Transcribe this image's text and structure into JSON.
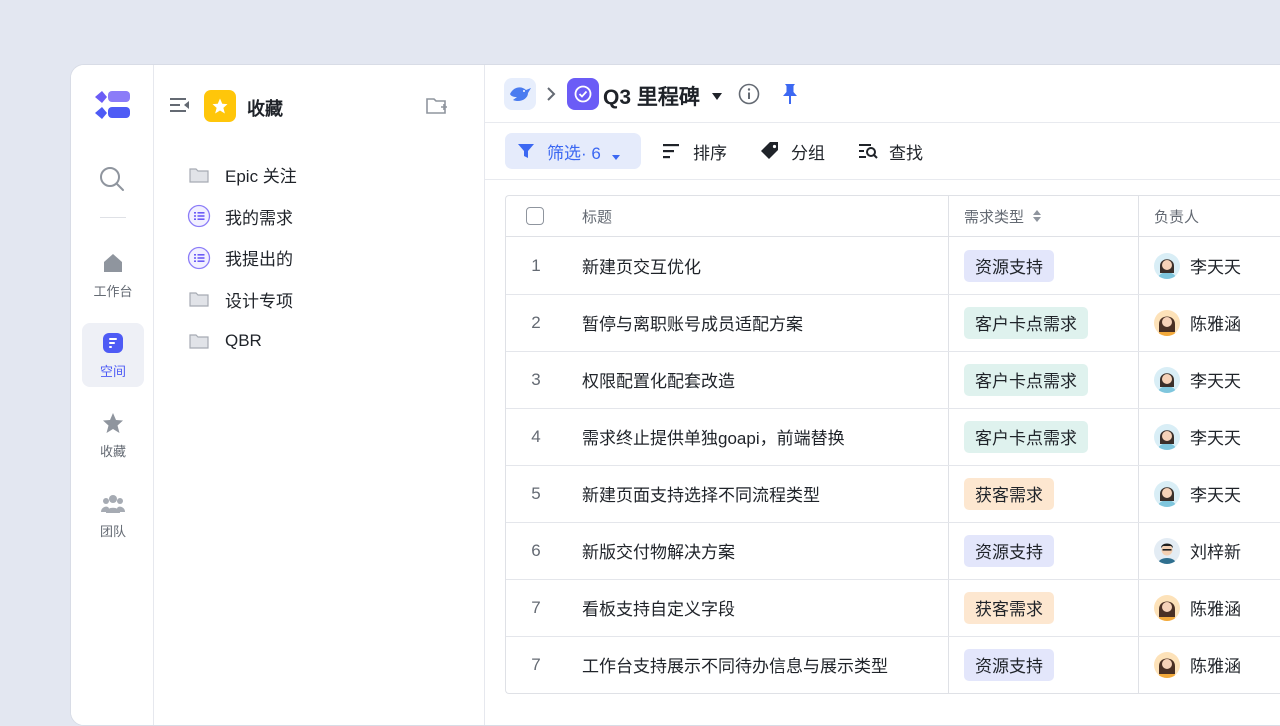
{
  "rail": {
    "items": [
      {
        "label": "工作台",
        "icon": "home-icon"
      },
      {
        "label": "空间",
        "icon": "space-icon",
        "active": true
      },
      {
        "label": "收藏",
        "icon": "star-icon"
      },
      {
        "label": "团队",
        "icon": "team-icon"
      }
    ]
  },
  "sidebar": {
    "title": "收藏",
    "items": [
      {
        "label": "Epic 关注",
        "icon": "folder-icon"
      },
      {
        "label": "我的需求",
        "icon": "list-view-icon"
      },
      {
        "label": "我提出的",
        "icon": "list-view-icon"
      },
      {
        "label": "设计专项",
        "icon": "folder-icon"
      },
      {
        "label": "QBR",
        "icon": "folder-icon"
      }
    ]
  },
  "header": {
    "project_title": "Q3 里程碑"
  },
  "toolbar": {
    "filter_label": "筛选· 6",
    "sort_label": "排序",
    "group_label": "分组",
    "find_label": "查找"
  },
  "table": {
    "columns": {
      "title": "标题",
      "type": "需求类型",
      "owner": "负责人"
    },
    "rows": [
      {
        "index": "1",
        "title": "新建页交互优化",
        "type": "资源支持",
        "type_color": "blue",
        "owner": "李天天",
        "avatar": "female-a"
      },
      {
        "index": "2",
        "title": "暂停与离职账号成员适配方案",
        "type": "客户卡点需求",
        "type_color": "teal",
        "owner": "陈雅涵",
        "avatar": "female-b"
      },
      {
        "index": "3",
        "title": "权限配置化配套改造",
        "type": "客户卡点需求",
        "type_color": "teal",
        "owner": "李天天",
        "avatar": "female-a"
      },
      {
        "index": "4",
        "title": "需求终止提供单独goapi，前端替换",
        "type": "客户卡点需求",
        "type_color": "teal",
        "owner": "李天天",
        "avatar": "female-a"
      },
      {
        "index": "5",
        "title": "新建页面支持选择不同流程类型",
        "type": "获客需求",
        "type_color": "orange",
        "owner": "李天天",
        "avatar": "female-a"
      },
      {
        "index": "6",
        "title": "新版交付物解决方案",
        "type": "资源支持",
        "type_color": "blue",
        "owner": "刘梓新",
        "avatar": "male-a"
      },
      {
        "index": "7",
        "title": "看板支持自定义字段",
        "type": "获客需求",
        "type_color": "orange",
        "owner": "陈雅涵",
        "avatar": "female-b"
      },
      {
        "index": "7",
        "title": "工作台支持展示不同待办信息与展示类型",
        "type": "资源支持",
        "type_color": "blue",
        "owner": "陈雅涵",
        "avatar": "female-b"
      }
    ]
  },
  "colors": {
    "accent": "#3c68f2",
    "brand_purple": "#6b5cf6",
    "favorite_yellow": "#ffc60a",
    "tag_blue": "#e3e6fb",
    "tag_teal": "#dff2ee",
    "tag_orange": "#fde7d0"
  }
}
